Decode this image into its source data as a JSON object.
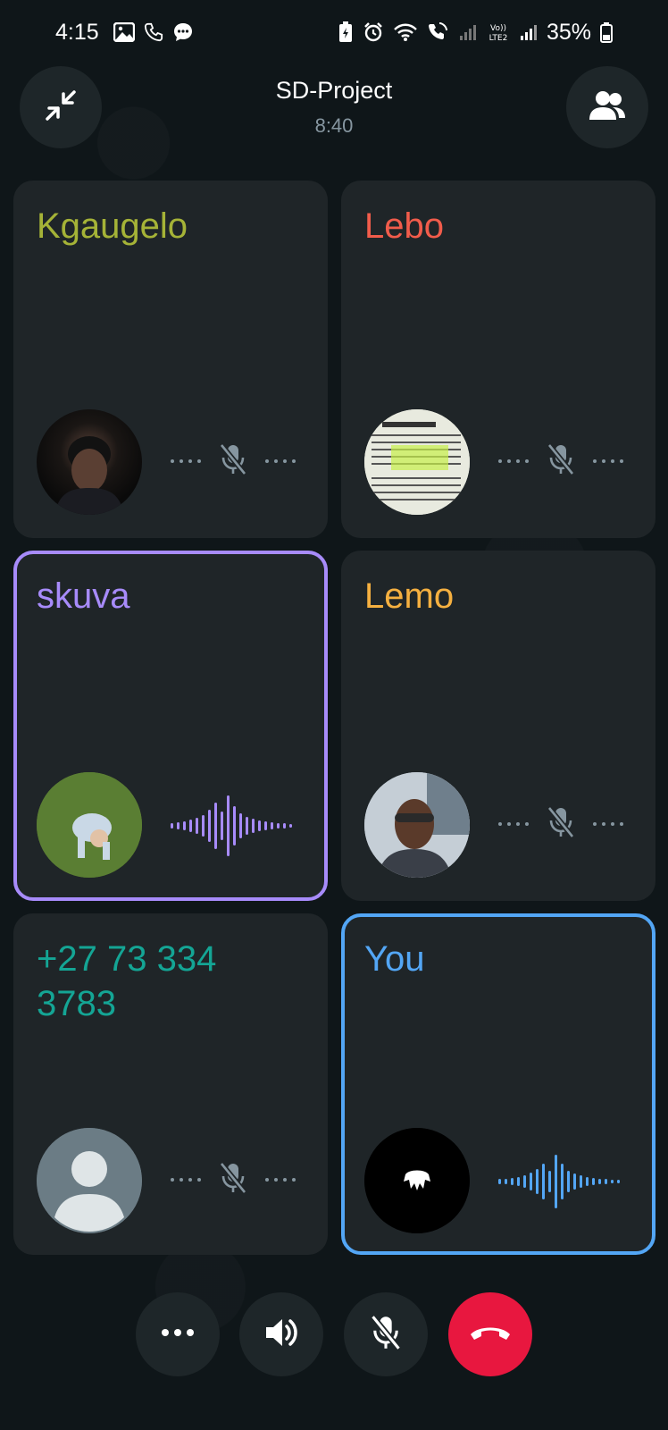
{
  "status_bar": {
    "time": "4:15",
    "battery": "35%"
  },
  "header": {
    "title": "SD-Project",
    "timer": "8:40",
    "minimize_icon": "minimize-icon",
    "participants_icon": "participants-icon"
  },
  "participants": [
    {
      "name": "Kgaugelo",
      "color": "#a5b337",
      "state": "muted"
    },
    {
      "name": "Lebo",
      "color": "#f15c4b",
      "state": "muted"
    },
    {
      "name": "skuva",
      "color": "#a78bfa",
      "state": "speaking"
    },
    {
      "name": "Lemo",
      "color": "#f5b040",
      "state": "muted"
    },
    {
      "name": "+27 73 334 3783",
      "color": "#14a595",
      "state": "muted"
    },
    {
      "name": "You",
      "color": "#53a6f5",
      "state": "speaking"
    }
  ],
  "controls": {
    "more_icon": "more-icon",
    "speaker_icon": "speaker-icon",
    "mic_icon": "mic-off-icon",
    "end_icon": "end-call-icon"
  },
  "colors": {
    "background": "#0f1619",
    "tile": "#1f2528",
    "end_call": "#e8173f",
    "muted_gray": "#8696a0"
  }
}
